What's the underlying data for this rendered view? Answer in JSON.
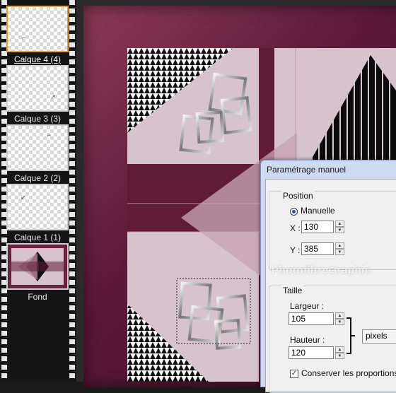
{
  "layers": [
    {
      "label": "Calque 4 (4)",
      "selected": true
    },
    {
      "label": "Calque 3 (3)",
      "selected": false
    },
    {
      "label": "Calque 2 (2)",
      "selected": false
    },
    {
      "label": "Calque 1 (1)",
      "selected": false
    },
    {
      "label": "Fond",
      "selected": false
    }
  ],
  "dialog": {
    "title": "Paramétrage manuel",
    "position": {
      "group_label": "Position",
      "mode_label": "Manuelle",
      "x_label": "X :",
      "x_value": "130",
      "y_label": "Y :",
      "y_value": "385"
    },
    "size": {
      "group_label": "Taille",
      "width_label": "Largeur :",
      "width_value": "105",
      "height_label": "Hauteur :",
      "height_value": "120",
      "unit": "pixels",
      "keep_ratio_label": "Conserver les proportions",
      "keep_ratio_checked": true
    }
  },
  "watermark": "PhotofiltreGraphic",
  "colors": {
    "selection_border": "#f0a020",
    "frame": "#5a1838",
    "art_background": "#d7c3cb",
    "band": "#5e1c36"
  }
}
